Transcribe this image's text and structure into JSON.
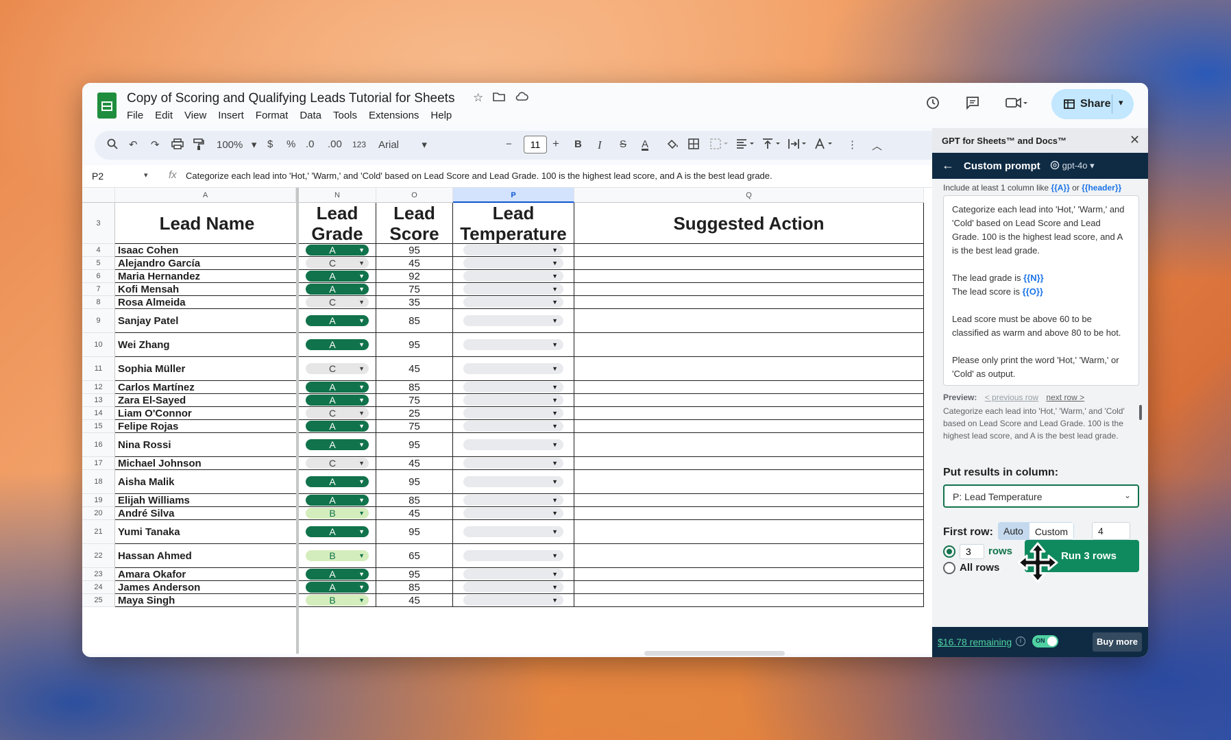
{
  "window": {
    "doc_title": "Copy of Scoring and Qualifying Leads Tutorial for Sheets",
    "menu": [
      "File",
      "Edit",
      "View",
      "Insert",
      "Format",
      "Data",
      "Tools",
      "Extensions",
      "Help"
    ],
    "share_label": "Share"
  },
  "toolbar": {
    "zoom": "100%",
    "currency": "$",
    "percent": "%",
    "dec_decrease": ".0",
    "dec_increase": ".00",
    "number_format": "123",
    "font": "Arial",
    "font_size": "11",
    "bold": "B",
    "italic": "I",
    "strike": "S",
    "text_color": "A"
  },
  "formula_bar": {
    "cell_ref": "P2",
    "fx": "fx",
    "formula": "Categorize each lead into 'Hot,' 'Warm,' and 'Cold' based on Lead Score and Lead Grade. 100 is the highest lead score, and A is the best lead grade."
  },
  "grid": {
    "column_letters": [
      "A",
      "N",
      "O",
      "P",
      "Q"
    ],
    "header_row_number": "3",
    "headers": {
      "name": "Lead Name",
      "grade": "Lead Grade",
      "score": "Lead Score",
      "temperature": "Lead Temperature",
      "action": "Suggested Action"
    },
    "rows": [
      {
        "num": "4",
        "name": "Isaac Cohen",
        "grade": "A",
        "score": "95"
      },
      {
        "num": "5",
        "name": "Alejandro García",
        "grade": "C",
        "score": "45"
      },
      {
        "num": "6",
        "name": "Maria Hernandez",
        "grade": "A",
        "score": "92"
      },
      {
        "num": "7",
        "name": "Kofi Mensah",
        "grade": "A",
        "score": "75"
      },
      {
        "num": "8",
        "name": "Rosa Almeida",
        "grade": "C",
        "score": "35"
      },
      {
        "num": "9",
        "name": "Sanjay Patel",
        "grade": "A",
        "score": "85"
      },
      {
        "num": "10",
        "name": "Wei Zhang",
        "grade": "A",
        "score": "95"
      },
      {
        "num": "11",
        "name": "Sophia Müller",
        "grade": "C",
        "score": "45"
      },
      {
        "num": "12",
        "name": "Carlos Martínez",
        "grade": "A",
        "score": "85"
      },
      {
        "num": "13",
        "name": "Zara El-Sayed",
        "grade": "A",
        "score": "75"
      },
      {
        "num": "14",
        "name": "Liam O'Connor",
        "grade": "C",
        "score": "25"
      },
      {
        "num": "15",
        "name": "Felipe Rojas",
        "grade": "A",
        "score": "75"
      },
      {
        "num": "16",
        "name": "Nina Rossi",
        "grade": "A",
        "score": "95"
      },
      {
        "num": "17",
        "name": "Michael Johnson",
        "grade": "C",
        "score": "45"
      },
      {
        "num": "18",
        "name": "Aisha Malik",
        "grade": "A",
        "score": "95"
      },
      {
        "num": "19",
        "name": "Elijah Williams",
        "grade": "A",
        "score": "85"
      },
      {
        "num": "20",
        "name": "André Silva",
        "grade": "B",
        "score": "45"
      },
      {
        "num": "21",
        "name": "Yumi Tanaka",
        "grade": "A",
        "score": "95"
      },
      {
        "num": "22",
        "name": "Hassan Ahmed",
        "grade": "B",
        "score": "65"
      },
      {
        "num": "23",
        "name": "Amara Okafor",
        "grade": "A",
        "score": "95"
      },
      {
        "num": "24",
        "name": "James Anderson",
        "grade": "A",
        "score": "85"
      },
      {
        "num": "25",
        "name": "Maya Singh",
        "grade": "B",
        "score": "45"
      }
    ]
  },
  "panel": {
    "addon_title": "GPT for Sheets™ and Docs™",
    "header": "Custom prompt",
    "model": "gpt-4o",
    "hint_prefix": "Include at least 1 column like ",
    "hint_var1": "{{A}}",
    "hint_or": " or ",
    "hint_var2": "{{header}}",
    "prompt_p1": "Categorize each lead into 'Hot,' 'Warm,' and 'Cold' based on Lead Score and Lead Grade. 100 is the highest lead score, and A is the best lead grade.",
    "prompt_grade_prefix": "The lead grade is ",
    "prompt_grade_var": "{{N}}",
    "prompt_score_prefix": "The lead score is ",
    "prompt_score_var": "{{O}}",
    "prompt_p3": "Lead score must be above 60 to be classified as warm and above 80 to be hot.",
    "prompt_p4": "Please only print the word 'Hot,' 'Warm,' or 'Cold' as output.",
    "preview_label": "Preview:",
    "previous_row": "< previous row",
    "next_row": "next row >",
    "preview_text": "Categorize each lead into 'Hot,' 'Warm,' and 'Cold' based on Lead Score and Lead Grade. 100 is the highest lead score, and A is the best lead grade.",
    "put_results_label": "Put results in column:",
    "results_column": "P: Lead Temperature",
    "first_row_label": "First row:",
    "auto_label": "Auto",
    "custom_label": "Custom",
    "first_row_value": "4",
    "num_rows": "3",
    "rows_label": "rows",
    "all_rows_label": "All rows",
    "run_label": "Run 3 rows",
    "remaining": "$16.78 remaining",
    "toggle_label": "ON",
    "buy_more": "Buy more"
  },
  "colors": {
    "grade_A_bg": "#11734b",
    "grade_B_bg": "#d4edbc",
    "grade_C_bg": "#e6e6e6",
    "panel_dark": "#0f2b44",
    "run_button": "#0f8a5f"
  }
}
